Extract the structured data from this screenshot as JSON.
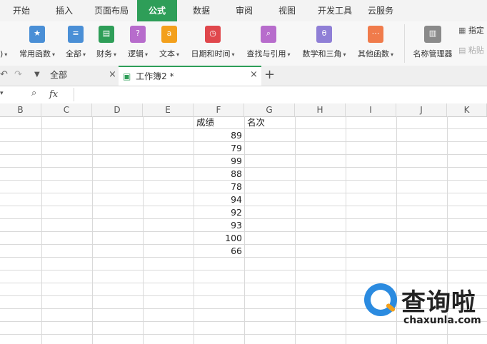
{
  "menu": {
    "tabs": [
      "开始",
      "插入",
      "页面布局",
      "公式",
      "数据",
      "审阅",
      "视图",
      "开发工具",
      "云服务"
    ],
    "active": "公式"
  },
  "ribbon": {
    "buttons": [
      {
        "label": "常用函数",
        "color": "#4a8fd6",
        "glyph": "★"
      },
      {
        "label": "全部",
        "color": "#4a8fd6",
        "glyph": "≡"
      },
      {
        "label": "财务",
        "color": "#2e9e58",
        "glyph": "▤"
      },
      {
        "label": "逻辑",
        "color": "#b76ccc",
        "glyph": "?"
      },
      {
        "label": "文本",
        "color": "#f3a01c",
        "glyph": "a"
      },
      {
        "label": "日期和时间",
        "color": "#e0474c",
        "glyph": "◷"
      },
      {
        "label": "查找与引用",
        "color": "#b76ccc",
        "glyph": "⌕"
      },
      {
        "label": "数学和三角",
        "color": "#8f7fd6",
        "glyph": "θ"
      },
      {
        "label": "其他函数",
        "color": "#f07b4b",
        "glyph": "⋯"
      }
    ],
    "name_manager": "名称管理器",
    "specify": "指定",
    "paste": "粘贴"
  },
  "doc_tabs": {
    "all_label": "全部",
    "workbook": "工作簿2 *",
    "add": "+",
    "close": "×"
  },
  "formula_bar": {
    "fx": "fx",
    "value": ""
  },
  "columns": [
    "B",
    "C",
    "D",
    "E",
    "F",
    "G",
    "H",
    "I",
    "J",
    "K"
  ],
  "sheet": {
    "headers": {
      "F": "成绩",
      "G": "名次"
    },
    "scores": [
      "89",
      "79",
      "99",
      "88",
      "78",
      "94",
      "92",
      "93",
      "100",
      "66"
    ]
  },
  "watermark": {
    "text": "查询啦",
    "url": "chaxunla.com"
  },
  "colors": {
    "accent": "#2e9e58",
    "tab_bar": "#f3f3f3",
    "ribbon": "#f7f7f7",
    "grid_line": "#d9d9d9"
  }
}
